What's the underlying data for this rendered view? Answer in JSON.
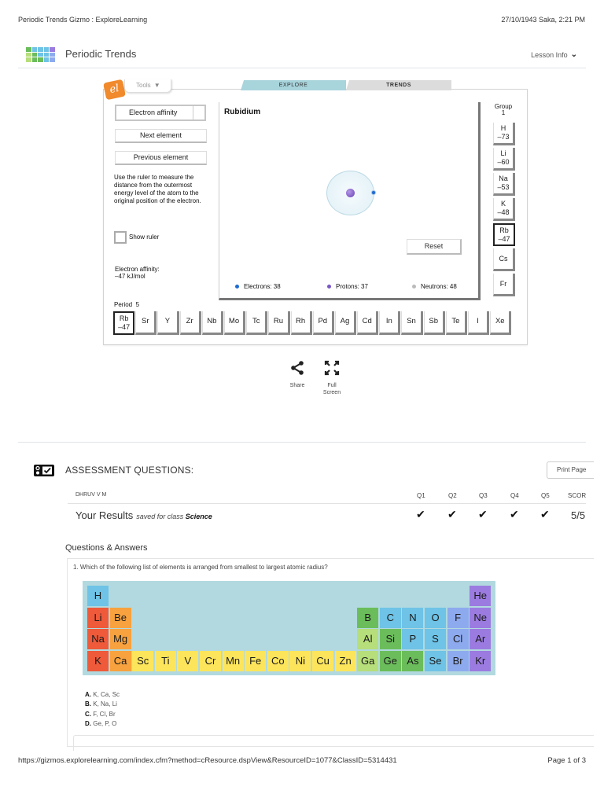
{
  "print_header": {
    "page_title": "Periodic Trends Gizmo : ExploreLearning",
    "datetime": "27/10/1943 Saka, 2:21 PM"
  },
  "app_header": {
    "title": "Periodic Trends",
    "lesson_info_label": "Lesson Info"
  },
  "gizmo": {
    "tools_label": "Tools",
    "tabs": [
      {
        "label": "EXPLORE",
        "active": true
      },
      {
        "label": "TRENDS",
        "active": false
      }
    ],
    "property_select": "Electron affinity",
    "next_button": "Next element",
    "prev_button": "Previous element",
    "instructions": "Use the ruler to measure the distance from the outermost energy level of the atom to the original position of the electron.",
    "show_ruler_label": "Show ruler",
    "show_ruler_checked": false,
    "readout_label": "Electron affinity:",
    "readout_value": "–47 kJ/mol",
    "element_name": "Rubidium",
    "reset_button": "Reset",
    "legend": {
      "electrons": "Electrons: 38",
      "protons": "Protons: 37",
      "neutrons": "Neutrons: 48"
    },
    "group": {
      "label": "Group",
      "number": "1",
      "cells": [
        {
          "symbol": "H",
          "value": "–73",
          "selected": false
        },
        {
          "symbol": "Li",
          "value": "–60",
          "selected": false
        },
        {
          "symbol": "Na",
          "value": "–53",
          "selected": false
        },
        {
          "symbol": "K",
          "value": "–48",
          "selected": false
        },
        {
          "symbol": "Rb",
          "value": "–47",
          "selected": true
        },
        {
          "symbol": "Cs",
          "value": "",
          "selected": false
        },
        {
          "symbol": "Fr",
          "value": "",
          "selected": false
        }
      ]
    },
    "period": {
      "label": "Period",
      "number": "5",
      "cells": [
        {
          "symbol": "Rb",
          "value": "–47",
          "selected": true
        },
        {
          "symbol": "Sr",
          "value": ""
        },
        {
          "symbol": "Y",
          "value": ""
        },
        {
          "symbol": "Zr",
          "value": ""
        },
        {
          "symbol": "Nb",
          "value": ""
        },
        {
          "symbol": "Mo",
          "value": ""
        },
        {
          "symbol": "Tc",
          "value": ""
        },
        {
          "symbol": "Ru",
          "value": ""
        },
        {
          "symbol": "Rh",
          "value": ""
        },
        {
          "symbol": "Pd",
          "value": ""
        },
        {
          "symbol": "Ag",
          "value": ""
        },
        {
          "symbol": "Cd",
          "value": ""
        },
        {
          "symbol": "In",
          "value": ""
        },
        {
          "symbol": "Sn",
          "value": ""
        },
        {
          "symbol": "Sb",
          "value": ""
        },
        {
          "symbol": "Te",
          "value": ""
        },
        {
          "symbol": "I",
          "value": ""
        },
        {
          "symbol": "Xe",
          "value": ""
        }
      ]
    }
  },
  "actions": {
    "share_label": "Share",
    "fullscreen_label": "Full Screen"
  },
  "assessment": {
    "title": "ASSESSMENT QUESTIONS:",
    "print_button": "Print Page",
    "student_name": "DHRUV V M",
    "columns": [
      "Q1",
      "Q2",
      "Q3",
      "Q4",
      "Q5",
      "SCORE"
    ],
    "results_label": "Your Results",
    "saved_for_prefix": "saved for class",
    "class_name": "Science",
    "checks": [
      "✔",
      "✔",
      "✔",
      "✔",
      "✔"
    ],
    "score": "5/5"
  },
  "qa": {
    "title": "Questions & Answers",
    "question_1": "1. Which of the following list of elements is arranged from smallest to largest atomic radius?",
    "answers": [
      {
        "letter": "A.",
        "text": "K, Ca, Sc"
      },
      {
        "letter": "B.",
        "text": "K, Na, Li"
      },
      {
        "letter": "C.",
        "text": "F, Cl, Br"
      },
      {
        "letter": "D.",
        "text": "Ge, P, O"
      }
    ],
    "periodic_table": [
      {
        "symbol": "H",
        "row": 0,
        "col": 0,
        "color": "#6ec3e6"
      },
      {
        "symbol": "He",
        "row": 0,
        "col": 17,
        "color": "#9b7be0"
      },
      {
        "symbol": "Li",
        "row": 1,
        "col": 0,
        "color": "#ee5a3a"
      },
      {
        "symbol": "Be",
        "row": 1,
        "col": 1,
        "color": "#f7a23e"
      },
      {
        "symbol": "B",
        "row": 1,
        "col": 12,
        "color": "#6bbd5b"
      },
      {
        "symbol": "C",
        "row": 1,
        "col": 13,
        "color": "#6ec3e6"
      },
      {
        "symbol": "N",
        "row": 1,
        "col": 14,
        "color": "#6ec3e6"
      },
      {
        "symbol": "O",
        "row": 1,
        "col": 15,
        "color": "#6ec3e6"
      },
      {
        "symbol": "F",
        "row": 1,
        "col": 16,
        "color": "#8eaaee"
      },
      {
        "symbol": "Ne",
        "row": 1,
        "col": 17,
        "color": "#9b7be0"
      },
      {
        "symbol": "Na",
        "row": 2,
        "col": 0,
        "color": "#ee5a3a"
      },
      {
        "symbol": "Mg",
        "row": 2,
        "col": 1,
        "color": "#f7a23e"
      },
      {
        "symbol": "Al",
        "row": 2,
        "col": 12,
        "color": "#b6de7a"
      },
      {
        "symbol": "Si",
        "row": 2,
        "col": 13,
        "color": "#6bbd5b"
      },
      {
        "symbol": "P",
        "row": 2,
        "col": 14,
        "color": "#6ec3e6"
      },
      {
        "symbol": "S",
        "row": 2,
        "col": 15,
        "color": "#6ec3e6"
      },
      {
        "symbol": "Cl",
        "row": 2,
        "col": 16,
        "color": "#8eaaee"
      },
      {
        "symbol": "Ar",
        "row": 2,
        "col": 17,
        "color": "#9b7be0"
      },
      {
        "symbol": "K",
        "row": 3,
        "col": 0,
        "color": "#ee5a3a"
      },
      {
        "symbol": "Ca",
        "row": 3,
        "col": 1,
        "color": "#f7a23e"
      },
      {
        "symbol": "Sc",
        "row": 3,
        "col": 2,
        "color": "#fde55b"
      },
      {
        "symbol": "Ti",
        "row": 3,
        "col": 3,
        "color": "#fde55b"
      },
      {
        "symbol": "V",
        "row": 3,
        "col": 4,
        "color": "#fde55b"
      },
      {
        "symbol": "Cr",
        "row": 3,
        "col": 5,
        "color": "#fde55b"
      },
      {
        "symbol": "Mn",
        "row": 3,
        "col": 6,
        "color": "#fde55b"
      },
      {
        "symbol": "Fe",
        "row": 3,
        "col": 7,
        "color": "#fde55b"
      },
      {
        "symbol": "Co",
        "row": 3,
        "col": 8,
        "color": "#fde55b"
      },
      {
        "symbol": "Ni",
        "row": 3,
        "col": 9,
        "color": "#fde55b"
      },
      {
        "symbol": "Cu",
        "row": 3,
        "col": 10,
        "color": "#fde55b"
      },
      {
        "symbol": "Zn",
        "row": 3,
        "col": 11,
        "color": "#fde55b"
      },
      {
        "symbol": "Ga",
        "row": 3,
        "col": 12,
        "color": "#b6de7a"
      },
      {
        "symbol": "Ge",
        "row": 3,
        "col": 13,
        "color": "#6bbd5b"
      },
      {
        "symbol": "As",
        "row": 3,
        "col": 14,
        "color": "#6bbd5b"
      },
      {
        "symbol": "Se",
        "row": 3,
        "col": 15,
        "color": "#6ec3e6"
      },
      {
        "symbol": "Br",
        "row": 3,
        "col": 16,
        "color": "#8eaaee"
      },
      {
        "symbol": "Kr",
        "row": 3,
        "col": 17,
        "color": "#9b7be0"
      }
    ]
  },
  "footer": {
    "url": "https://gizmos.explorelearning.com/index.cfm?method=cResource.dspView&ResourceID=1077&ClassID=5314431",
    "page": "Page 1 of 3"
  },
  "colors": {
    "explore_tab": "#a8d4dc",
    "table_background": "#b1d9df",
    "el_logo": "#f08a2c"
  }
}
